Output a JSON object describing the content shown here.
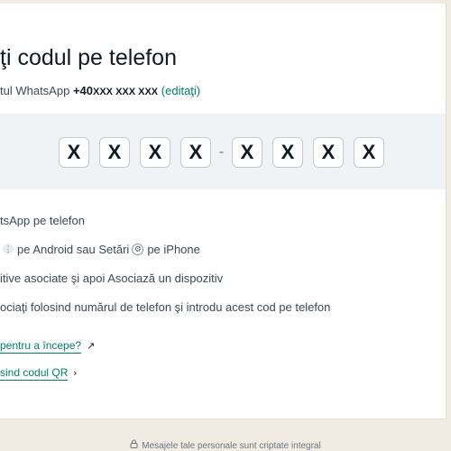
{
  "title": "ţi codul pe telefon",
  "subtitle": {
    "prefix": "tul WhatsApp ",
    "phone_prefix": "+40",
    "phone_rest": "XXX XXX XXX",
    "edit_label": "(editaţi)"
  },
  "code": {
    "chars": [
      "X",
      "X",
      "X",
      "X",
      "X",
      "X",
      "X",
      "X"
    ],
    "separator": "-"
  },
  "steps": [
    {
      "text": "tsApp pe telefon"
    },
    {
      "before": "",
      "icon1": "⋮",
      "middle": " pe Android sau Setări ",
      "icon2": "⚙",
      "after": " pe iPhone"
    },
    {
      "text": "itive asociate şi apoi Asociază un dispozitiv"
    },
    {
      "text": "ociaţi folosind numărul de telefon şi introdu acest cod pe telefon"
    }
  ],
  "help_link": {
    "label": " pentru a începe?",
    "arrow": "↗"
  },
  "qr_link": {
    "label": "sind codul QR",
    "arrow": "›"
  },
  "footer": {
    "icon": "lock-icon",
    "text": "Mesajele tale personale sunt criptate integral"
  },
  "colors": {
    "accent": "#008069",
    "page_bg": "#f0ebe3",
    "code_band_bg": "#f0f2f5"
  }
}
